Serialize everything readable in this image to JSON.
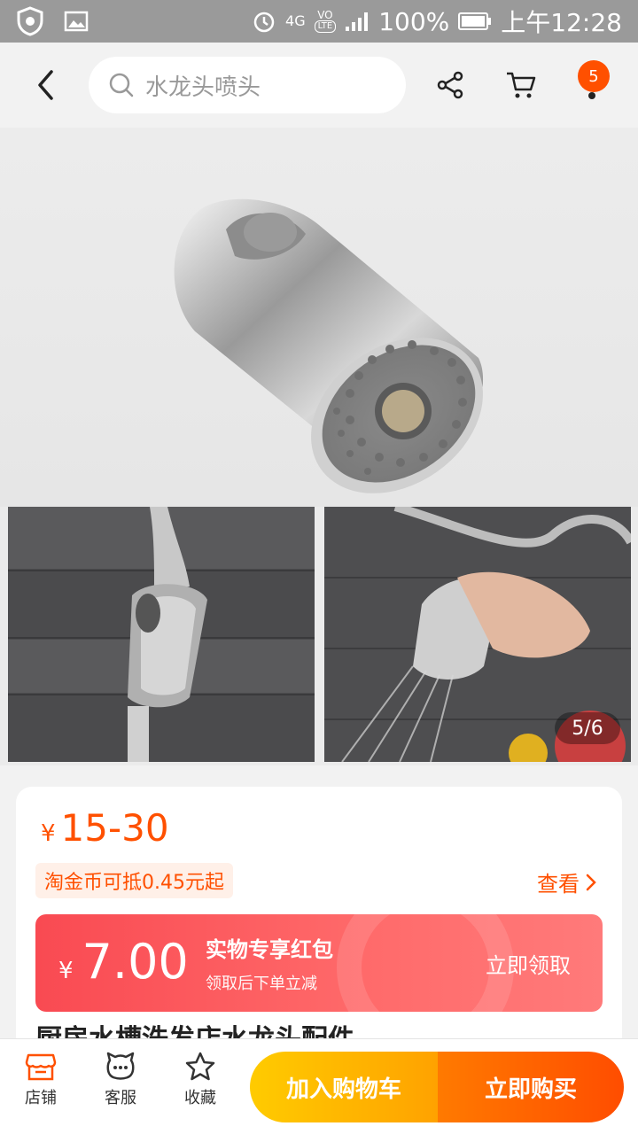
{
  "status_bar": {
    "network": "4G",
    "volte": "LTE",
    "battery": "100%",
    "time": "上午12:28"
  },
  "header": {
    "search_text": "水龙头喷头",
    "cart_badge": "5"
  },
  "gallery": {
    "counter": "5/6"
  },
  "product": {
    "price_symbol": "¥",
    "price": "15-30",
    "coin_tag": "淘金币可抵0.45元起",
    "view_label": "查看",
    "title_peek": "厨房水槽洗发店水龙头配件"
  },
  "coupon": {
    "symbol": "¥",
    "amount": "7.00",
    "title": "实物专享红包",
    "subtitle": "领取后下单立减",
    "claim_label": "立即领取"
  },
  "bottom_bar": {
    "store_label": "店铺",
    "service_label": "客服",
    "favorite_label": "收藏",
    "add_to_cart_label": "加入购物车",
    "buy_now_label": "立即购买"
  },
  "colors": {
    "accent": "#ff5000",
    "coupon": "#f94a52",
    "cart_button": "#ffb400",
    "buy_button": "#ff5a00"
  }
}
